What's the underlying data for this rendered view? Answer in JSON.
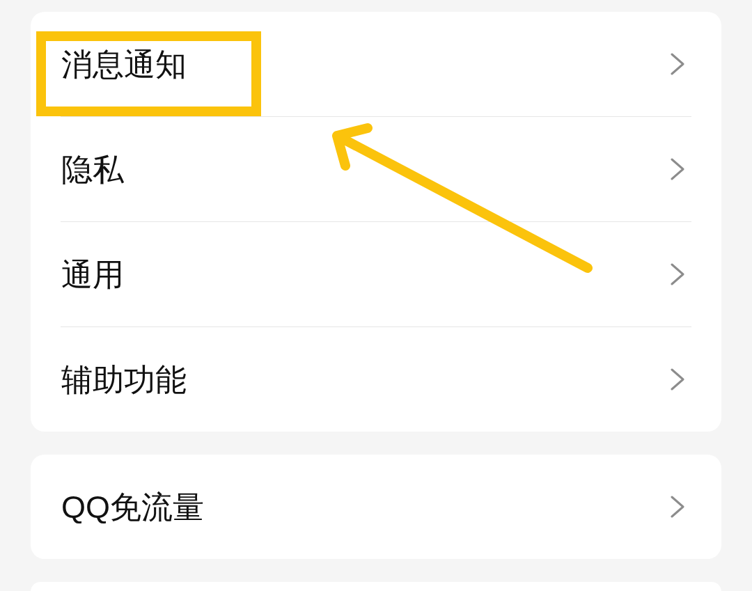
{
  "groups": [
    {
      "items": [
        {
          "label": "消息通知",
          "highlighted": true
        },
        {
          "label": "隐私",
          "highlighted": false
        },
        {
          "label": "通用",
          "highlighted": false
        },
        {
          "label": "辅助功能",
          "highlighted": false
        }
      ],
      "cut_off": false
    },
    {
      "items": [
        {
          "label": "QQ免流量",
          "highlighted": false
        }
      ],
      "cut_off": false
    },
    {
      "cut_off": true
    }
  ]
}
